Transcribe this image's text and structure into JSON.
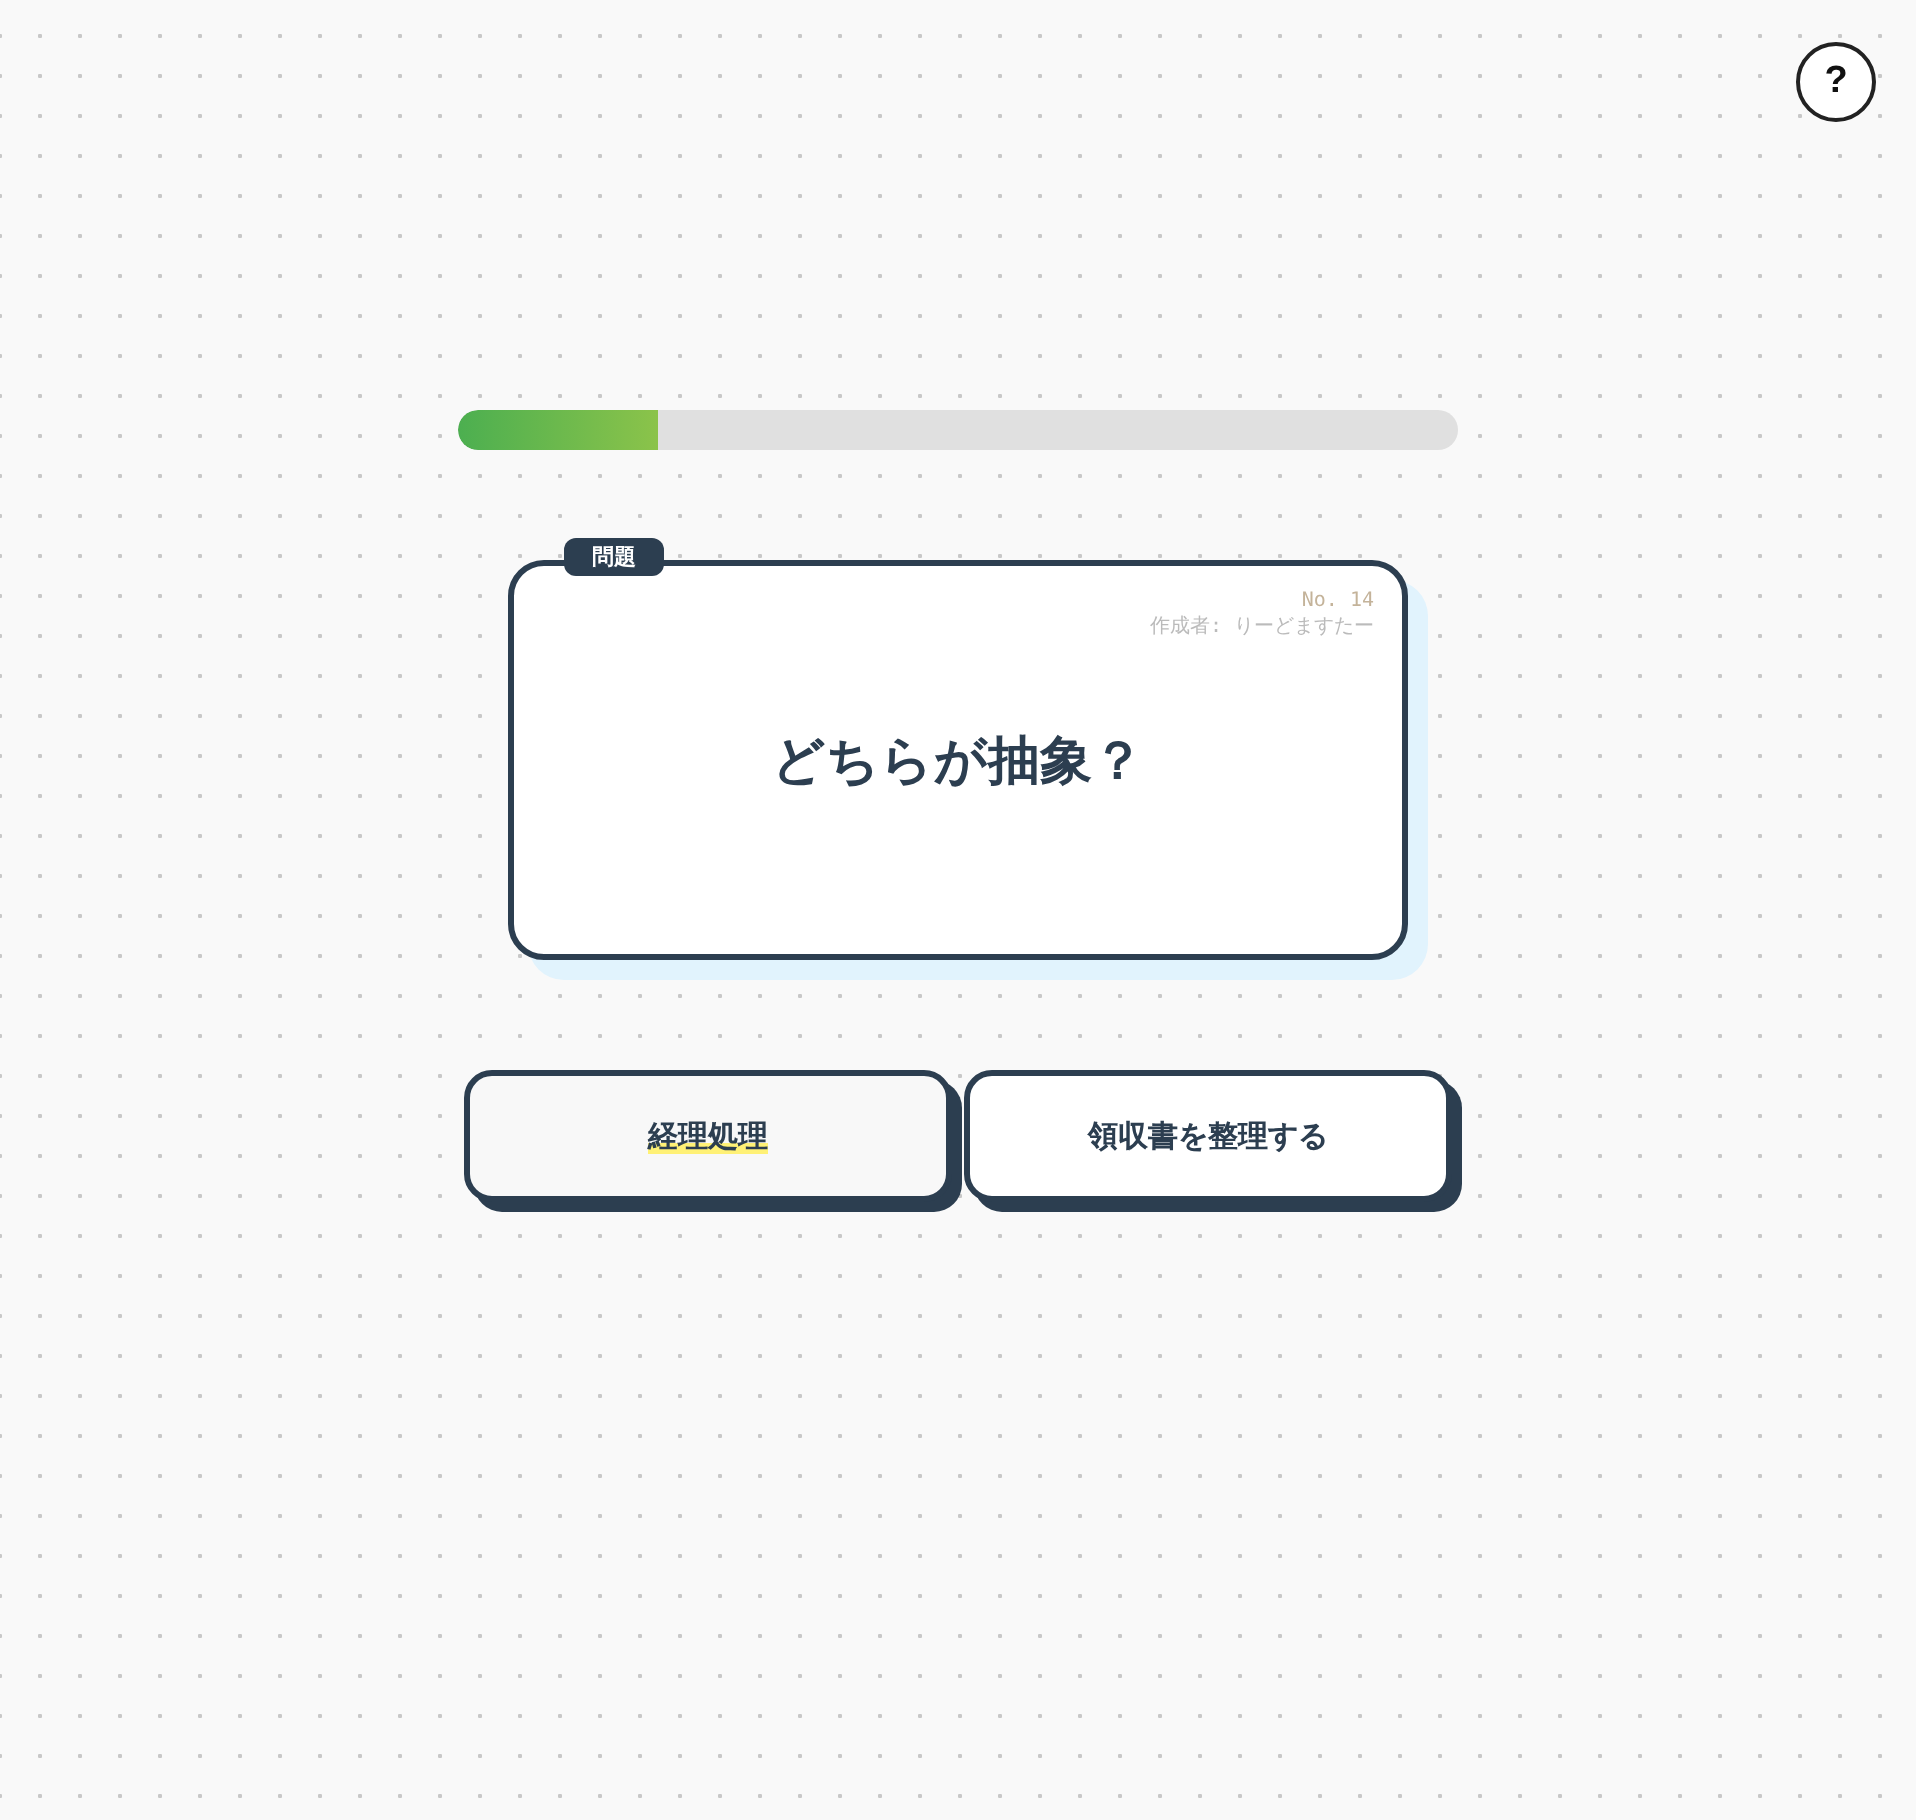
{
  "help_button": {
    "label": "?"
  },
  "progress": {
    "level": 0.2
  },
  "question_card": {
    "tag": "問題",
    "number": "No. 14",
    "author": "作成者: りーどますたー",
    "question": "どちらが抽象？"
  },
  "options": [
    {
      "label": "経理処理",
      "selected": true
    },
    {
      "label": "領収書を整理する",
      "selected": false
    }
  ]
}
